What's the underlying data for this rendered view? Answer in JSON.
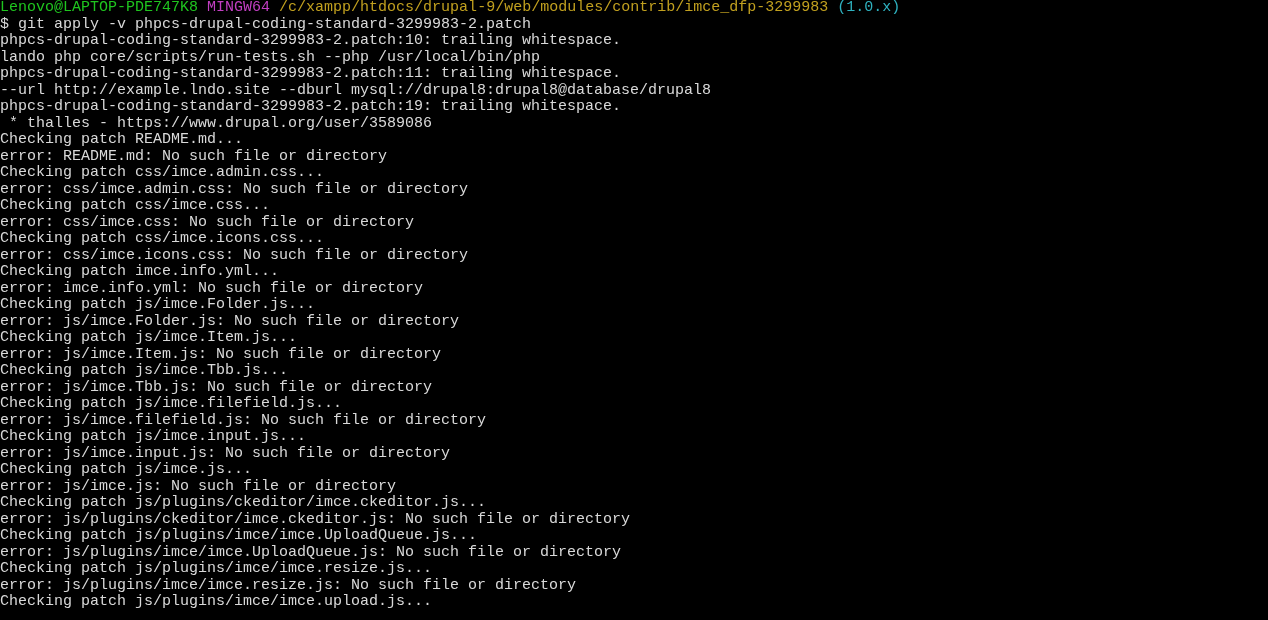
{
  "prompt": {
    "user_host": "Lenovo@LAPTOP-PDE747K8",
    "system": "MINGW64",
    "path": "/c/xampp/htdocs/drupal-9/web/modules/contrib/imce_dfp-3299983",
    "branch": "(1.0.x)"
  },
  "command": "$ git apply -v phpcs-drupal-coding-standard-3299983-2.patch",
  "output": [
    "phpcs-drupal-coding-standard-3299983-2.patch:10: trailing whitespace.",
    "lando php core/scripts/run-tests.sh --php /usr/local/bin/php",
    "phpcs-drupal-coding-standard-3299983-2.patch:11: trailing whitespace.",
    "--url http://example.lndo.site --dburl mysql://drupal8:drupal8@database/drupal8",
    "phpcs-drupal-coding-standard-3299983-2.patch:19: trailing whitespace.",
    " * thalles - https://www.drupal.org/user/3589086",
    "Checking patch README.md...",
    "error: README.md: No such file or directory",
    "Checking patch css/imce.admin.css...",
    "error: css/imce.admin.css: No such file or directory",
    "Checking patch css/imce.css...",
    "error: css/imce.css: No such file or directory",
    "Checking patch css/imce.icons.css...",
    "error: css/imce.icons.css: No such file or directory",
    "Checking patch imce.info.yml...",
    "error: imce.info.yml: No such file or directory",
    "Checking patch js/imce.Folder.js...",
    "error: js/imce.Folder.js: No such file or directory",
    "Checking patch js/imce.Item.js...",
    "error: js/imce.Item.js: No such file or directory",
    "Checking patch js/imce.Tbb.js...",
    "error: js/imce.Tbb.js: No such file or directory",
    "Checking patch js/imce.filefield.js...",
    "error: js/imce.filefield.js: No such file or directory",
    "Checking patch js/imce.input.js...",
    "error: js/imce.input.js: No such file or directory",
    "Checking patch js/imce.js...",
    "error: js/imce.js: No such file or directory",
    "Checking patch js/plugins/ckeditor/imce.ckeditor.js...",
    "error: js/plugins/ckeditor/imce.ckeditor.js: No such file or directory",
    "Checking patch js/plugins/imce/imce.UploadQueue.js...",
    "error: js/plugins/imce/imce.UploadQueue.js: No such file or directory",
    "Checking patch js/plugins/imce/imce.resize.js...",
    "error: js/plugins/imce/imce.resize.js: No such file or directory",
    "Checking patch js/plugins/imce/imce.upload.js..."
  ]
}
